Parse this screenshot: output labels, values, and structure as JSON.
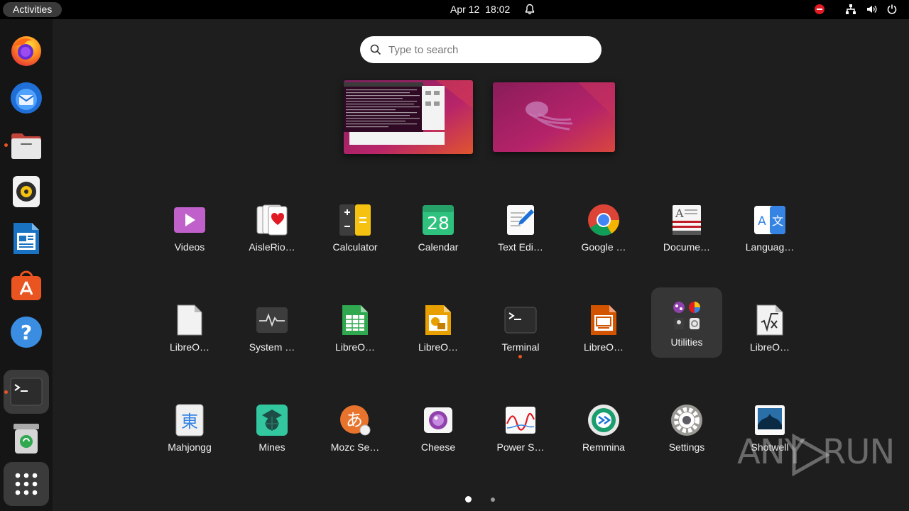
{
  "topbar": {
    "activities_label": "Activities",
    "date": "Apr 12",
    "time": "18:02"
  },
  "dock": {
    "items": [
      {
        "name": "firefox",
        "running": false
      },
      {
        "name": "thunderbird",
        "running": false
      },
      {
        "name": "files",
        "running": true
      },
      {
        "name": "rhythmbox",
        "running": false
      },
      {
        "name": "libreoffice-writer",
        "running": false
      },
      {
        "name": "app-center",
        "running": false
      },
      {
        "name": "help",
        "running": false
      },
      {
        "name": "terminal",
        "running": true
      },
      {
        "name": "trash",
        "running": false
      },
      {
        "name": "show-applications",
        "running": false
      }
    ]
  },
  "search": {
    "placeholder": "Type to search"
  },
  "apps": [
    {
      "label": "Videos",
      "icon": "videos-icon"
    },
    {
      "label": "AisleRio…",
      "icon": "aisleriot-icon"
    },
    {
      "label": "Calculator",
      "icon": "calculator-icon"
    },
    {
      "label": "Calendar",
      "icon": "calendar-icon",
      "day": "28"
    },
    {
      "label": "Text Edi…",
      "icon": "text-editor-icon"
    },
    {
      "label": "Google …",
      "icon": "chrome-icon"
    },
    {
      "label": "Docume…",
      "icon": "document-viewer-icon"
    },
    {
      "label": "Languag…",
      "icon": "language-icon"
    },
    {
      "label": "LibreO…",
      "icon": "libreoffice-icon"
    },
    {
      "label": "System …",
      "icon": "system-monitor-icon"
    },
    {
      "label": "LibreO…",
      "icon": "libreoffice-calc-icon"
    },
    {
      "label": "LibreO…",
      "icon": "libreoffice-draw-icon"
    },
    {
      "label": "Terminal",
      "icon": "terminal-icon",
      "running": true
    },
    {
      "label": "LibreO…",
      "icon": "libreoffice-impress-icon"
    },
    {
      "label": "Utilities",
      "icon": "utilities-folder-icon",
      "highlight": true
    },
    {
      "label": "LibreO…",
      "icon": "libreoffice-math-icon"
    },
    {
      "label": "Mahjongg",
      "icon": "mahjongg-icon"
    },
    {
      "label": "Mines",
      "icon": "mines-icon"
    },
    {
      "label": "Mozc Se…",
      "icon": "mozc-icon"
    },
    {
      "label": "Cheese",
      "icon": "cheese-icon"
    },
    {
      "label": "Power S…",
      "icon": "power-statistics-icon"
    },
    {
      "label": "Remmina",
      "icon": "remmina-icon"
    },
    {
      "label": "Settings",
      "icon": "settings-icon"
    },
    {
      "label": "Shotwell",
      "icon": "shotwell-icon"
    }
  ],
  "calendar_icon_day": "28",
  "mahjongg_glyph": "東",
  "mozc_glyph": "あ",
  "pager": {
    "pages": 2,
    "current": 1
  },
  "watermark": {
    "left": "ANY",
    "right": "RUN"
  },
  "colors": {
    "accent": "#e95420",
    "panel": "#000000",
    "dock": "#151515",
    "background": "#1e1e1e"
  }
}
